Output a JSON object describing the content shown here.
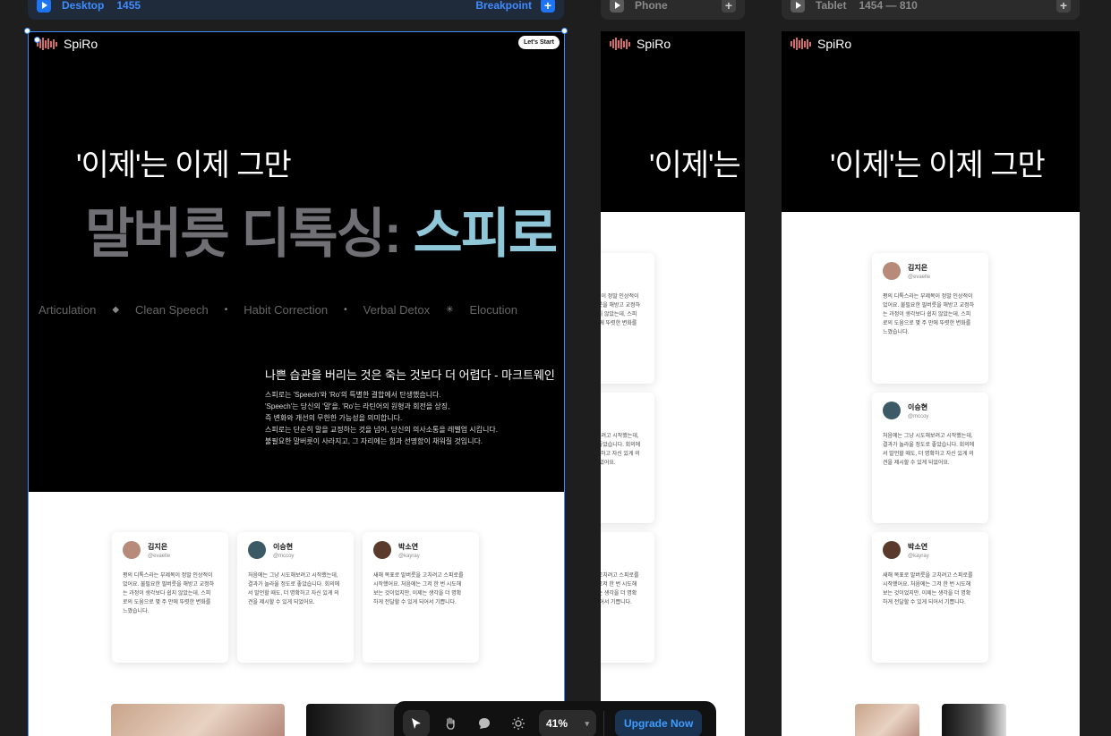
{
  "breakpoints": [
    {
      "name": "Desktop",
      "size": "1455",
      "right_label": "Breakpoint"
    },
    {
      "name": "Phone",
      "size": "",
      "right_label": ""
    },
    {
      "name": "Tablet",
      "size": "1454 — 810",
      "right_label": ""
    }
  ],
  "site": {
    "brand": "SpiRo",
    "cta": "Let's Start",
    "hero_line1": "'이제'는 이제 그만",
    "hero_line2_grey": "말버릇 디톡싱: ",
    "hero_line2_teal": "스피로",
    "marquee": [
      "Articulation",
      "Clean Speech",
      "Habit Correction",
      "Verbal Detox",
      "Elocution"
    ],
    "quote": "나쁜 습관을 버리는 것은 죽는 것보다 더 어렵다 - 마크트웨인",
    "body": [
      "스피로는 'Speech'와 'Ro'의 특별한 결합에서 탄생했습니다.",
      "'Speech'는 당신의 '말'을, 'Ro'는 라틴어의 원형과 회전을 상징,",
      "즉 변화와 개선의 무한한 가능성을 의미합니다.",
      "스피로는 단순히 말을 교정하는 것을 넘어, 당신의 의사소통을 레벨업 시킵니다.",
      "불필요한 말버릇이 사라지고, 그 자리에는 힘과 선명함이 채워질 것입니다."
    ],
    "testimonials": [
      {
        "name": "김지은",
        "handle": "@evaelle",
        "text": "평의 디톡스라는 부제목이 정말 인상적이\n었어요. 불필요한 필버릇을 해방고 교정하\n는 과정이 생각보다 쉽지 않았는데, 스피\n로의 도움으로 몇 주 만에 뚜렷한 변화를\n느꼈습니다."
      },
      {
        "name": "이승현",
        "handle": "@mccoy",
        "text": "처음에는 그냥 시도해보려고 시작했는데,\n결과가 놀라울 정도로 좋았습니다. 회의에\n서 발언할 때도, 더 명확하고 자신 있게 의\n견을 제시할 수 있게 되었어요."
      },
      {
        "name": "박소연",
        "handle": "@kayray",
        "text": "새해 목표로 말버릇을 고치려고 스피로를\n시작했어요. 처음에는 그저 한 번 시도해\n보는 것이었지만, 이제는 생각을 더 명확\n하게 전달할 수 있게 되어서 기쁩니다."
      }
    ]
  },
  "toolbar": {
    "zoom": "41%",
    "upgrade": "Upgrade Now"
  },
  "colors": {
    "accent": "#3f8cff",
    "teal": "#8fc7d8",
    "canvas": "#1e1e1e"
  }
}
